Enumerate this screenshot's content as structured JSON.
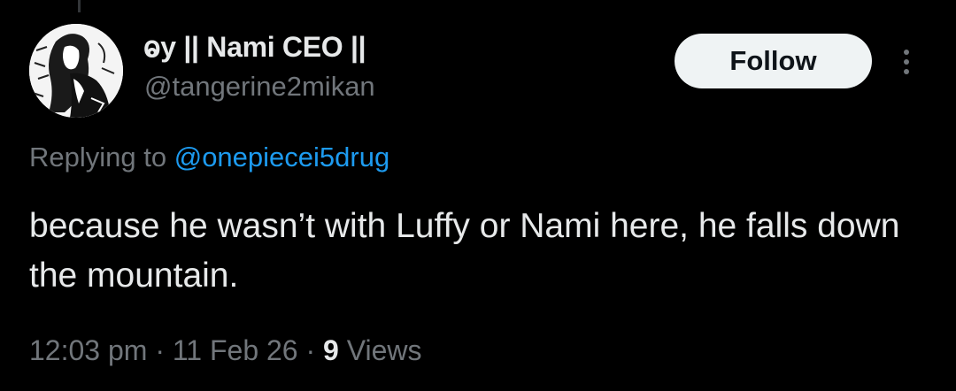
{
  "tweet": {
    "author": {
      "display_name": "ⱺy || Nami CEO ||",
      "handle": "@tangerine2mikan"
    },
    "follow_label": "Follow",
    "replying_prefix": "Replying to",
    "replying_mention": "@onepiecei5drug",
    "text": "because he wasn’t with Luffy or Nami here, he falls down the mountain.",
    "time": "12:03 pm",
    "date": "11 Feb 26",
    "separator": "·",
    "views_count": "9",
    "views_label": "Views"
  },
  "colors": {
    "background": "#000000",
    "primary_text": "#e7e9ea",
    "secondary_text": "#71767b",
    "link": "#1d9bf0",
    "button_bg": "#eff3f4"
  },
  "icons": {
    "more": "more-vertical-icon",
    "avatar": "manga-character-avatar"
  }
}
